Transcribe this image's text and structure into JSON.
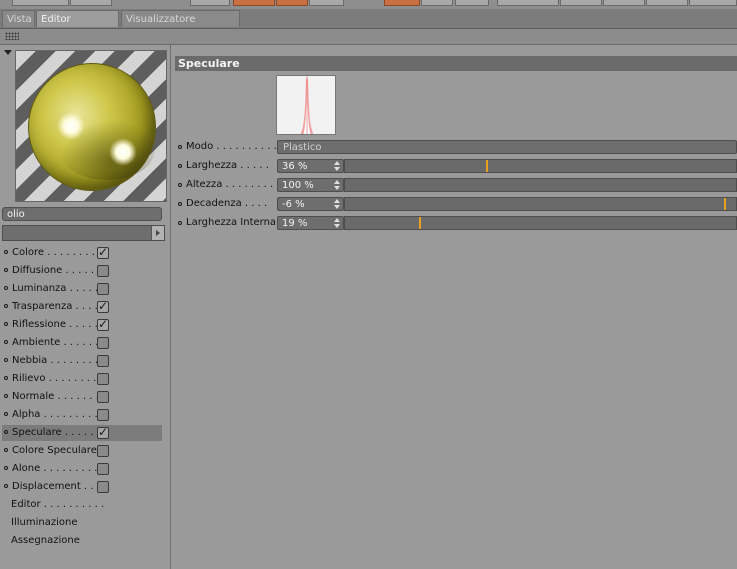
{
  "tabs": [
    {
      "label": "Vista",
      "active": false
    },
    {
      "label": "Editor Materiale",
      "active": true
    },
    {
      "label": "Visualizzatore Immagini",
      "active": false
    }
  ],
  "material": {
    "name": "olio",
    "sphere_color": "#c8c040"
  },
  "channels": [
    {
      "label": "Colore . . . . . . . . .",
      "checked": true
    },
    {
      "label": "Diffusione . . . . . .",
      "checked": false
    },
    {
      "label": "Luminanza . . . . . .",
      "checked": false
    },
    {
      "label": "Trasparenza . . . .",
      "checked": true
    },
    {
      "label": "Riflessione . . . . .",
      "checked": true
    },
    {
      "label": "Ambiente . . . . . . .",
      "checked": false
    },
    {
      "label": "Nebbia . . . . . . . . .",
      "checked": false
    },
    {
      "label": "Rilievo . . . . . . . . .",
      "checked": false
    },
    {
      "label": "Normale . . . . . . . .",
      "checked": false
    },
    {
      "label": "Alpha . . . . . . . . . .",
      "checked": false
    },
    {
      "label": "Speculare . . . . . . .",
      "checked": true,
      "selected": true
    },
    {
      "label": "Colore Speculare",
      "checked": false
    },
    {
      "label": "Alone . . . . . . . . . .",
      "checked": false
    },
    {
      "label": "Displacement . . .",
      "checked": false
    }
  ],
  "extra_items": [
    "Editor . . . . . . . . . .",
    "Illuminazione",
    "Assegnazione"
  ],
  "section_title": "Speculare",
  "mode": {
    "label": "Modo . . . . . . . . . .",
    "value": "Plastico"
  },
  "params": [
    {
      "label": "Larghezza . . . . .",
      "value": "36 %",
      "fraction": 0.36
    },
    {
      "label": "Altezza . . . . . . . .",
      "value": "100 %",
      "fraction": null
    },
    {
      "label": "Decadenza . . . .",
      "value": "-6 %",
      "fraction": 0.97
    },
    {
      "label": "Larghezza Interna",
      "value": "19 %",
      "fraction": 0.19
    }
  ],
  "colors": {
    "accent": "#e9a020",
    "panel": "#9a9a9a"
  }
}
